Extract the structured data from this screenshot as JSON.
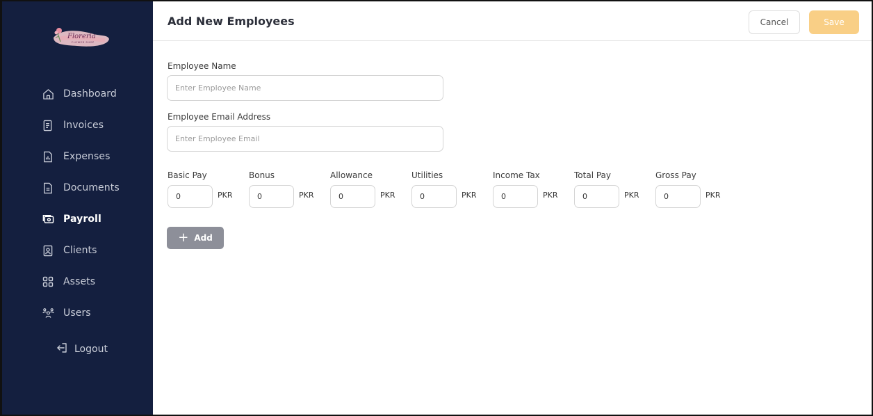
{
  "brand": {
    "logo_text": "Floreria",
    "logo_subtext": "FLOWER SHOP"
  },
  "sidebar": {
    "items": [
      {
        "label": "Dashboard",
        "icon": "home-icon",
        "active": false
      },
      {
        "label": "Invoices",
        "icon": "invoice-icon",
        "active": false
      },
      {
        "label": "Expenses",
        "icon": "expenses-icon",
        "active": false
      },
      {
        "label": "Documents",
        "icon": "document-icon",
        "active": false
      },
      {
        "label": "Payroll",
        "icon": "payroll-icon",
        "active": true
      },
      {
        "label": "Clients",
        "icon": "client-icon",
        "active": false
      },
      {
        "label": "Assets",
        "icon": "assets-icon",
        "active": false
      },
      {
        "label": "Users",
        "icon": "users-icon",
        "active": false
      }
    ],
    "logout_label": "Logout"
  },
  "header": {
    "title": "Add New Employees",
    "cancel_label": "Cancel",
    "save_label": "Save"
  },
  "form": {
    "name_label": "Employee Name",
    "name_placeholder": "Enter Employee Name",
    "email_label": "Employee Email Address",
    "email_placeholder": "Enter Employee Email",
    "pay_fields": [
      {
        "label": "Basic Pay",
        "value": "0",
        "unit": "PKR"
      },
      {
        "label": "Bonus",
        "value": "0",
        "unit": "PKR"
      },
      {
        "label": "Allowance",
        "value": "0",
        "unit": "PKR"
      },
      {
        "label": "Utilities",
        "value": "0",
        "unit": "PKR"
      },
      {
        "label": "Income Tax",
        "value": "0",
        "unit": "PKR"
      },
      {
        "label": "Total Pay",
        "value": "0",
        "unit": "PKR"
      },
      {
        "label": "Gross Pay",
        "value": "0",
        "unit": "PKR"
      }
    ],
    "add_label": "Add"
  },
  "colors": {
    "sidebar_bg": "#141f3f",
    "save_button": "#f9cf86",
    "add_button": "#8d8f99"
  }
}
